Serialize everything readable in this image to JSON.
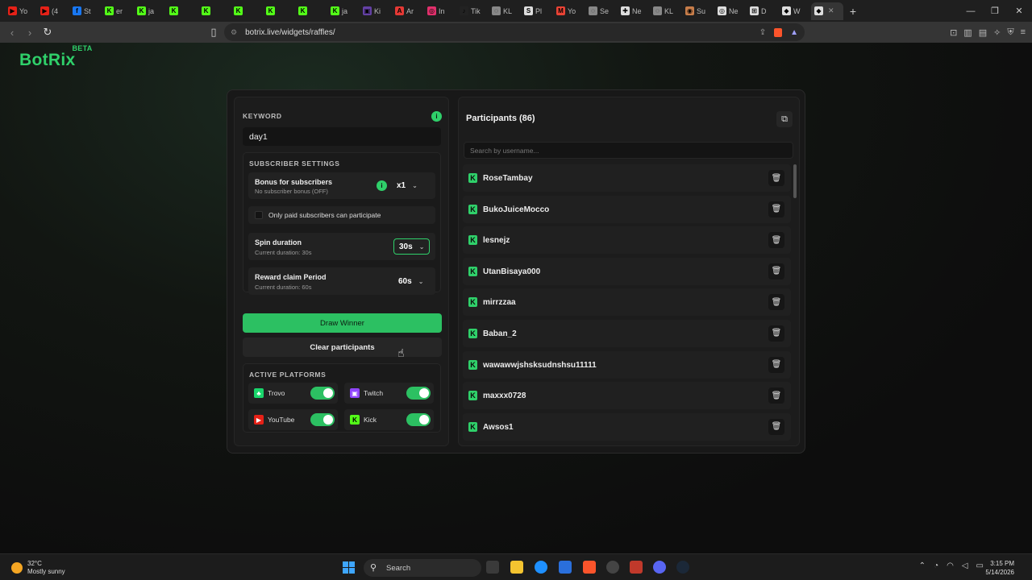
{
  "browser": {
    "tabs": [
      {
        "label": "Yo",
        "color": "#e62117",
        "glyph": "▶"
      },
      {
        "label": "(4",
        "color": "#e62117",
        "glyph": "▶"
      },
      {
        "label": "St",
        "color": "#1877f2",
        "glyph": "f"
      },
      {
        "label": "er",
        "color": "#53fc18",
        "glyph": "K"
      },
      {
        "label": "ja",
        "color": "#53fc18",
        "glyph": "K"
      },
      {
        "label": "",
        "color": "#53fc18",
        "glyph": "K"
      },
      {
        "label": "",
        "color": "#53fc18",
        "glyph": "K"
      },
      {
        "label": "",
        "color": "#53fc18",
        "glyph": "K"
      },
      {
        "label": "",
        "color": "#53fc18",
        "glyph": "K"
      },
      {
        "label": "",
        "color": "#53fc18",
        "glyph": "K"
      },
      {
        "label": "ja",
        "color": "#53fc18",
        "glyph": "K"
      },
      {
        "label": "Ki",
        "color": "#6441a5",
        "glyph": "▣"
      },
      {
        "label": "Ar",
        "color": "#e53935",
        "glyph": "A"
      },
      {
        "label": "In",
        "color": "#e1306c",
        "glyph": "◎"
      },
      {
        "label": "Tik",
        "color": "#222222",
        "glyph": "♪"
      },
      {
        "label": "KL",
        "color": "#888888",
        "glyph": "◌"
      },
      {
        "label": "Pl",
        "color": "#dddddd",
        "glyph": "S"
      },
      {
        "label": "Yo",
        "color": "#ea4335",
        "glyph": "M"
      },
      {
        "label": "Se",
        "color": "#888888",
        "glyph": "◌"
      },
      {
        "label": "Ne",
        "color": "#dddddd",
        "glyph": "✚"
      },
      {
        "label": "KL",
        "color": "#888888",
        "glyph": "◌"
      },
      {
        "label": "Su",
        "color": "#c77d4a",
        "glyph": "◉"
      },
      {
        "label": "Ne",
        "color": "#dddddd",
        "glyph": "◎"
      },
      {
        "label": "D",
        "color": "#dddddd",
        "glyph": "⊞"
      },
      {
        "label": "W",
        "color": "#dddddd",
        "glyph": "◆"
      },
      {
        "label": "",
        "color": "#dddddd",
        "glyph": "◆"
      }
    ],
    "new_tab": "+",
    "url": "botrix.live/widgets/raffles/",
    "win_minimize": "—",
    "win_restore": "❐",
    "win_close": "✕"
  },
  "app": {
    "logo": "BotRix",
    "logo_badge": "BETA"
  },
  "keyword": {
    "label": "KEYWORD",
    "value": "day1",
    "info": "i"
  },
  "subscriber": {
    "label": "SUBSCRIBER SETTINGS",
    "bonus_title": "Bonus for subscribers",
    "bonus_sub": "No subscriber bonus (OFF)",
    "bonus_value": "x1",
    "only_paid": "Only paid subscribers can participate",
    "spin_title": "Spin duration",
    "spin_sub": "Current duration: 30s",
    "spin_value": "30s",
    "reward_title": "Reward claim Period",
    "reward_sub": "Current duration: 60s",
    "reward_value": "60s"
  },
  "actions": {
    "draw": "Draw Winner",
    "clear": "Clear participants"
  },
  "platforms": {
    "label": "ACTIVE PLATFORMS",
    "items": [
      {
        "name": "Trovo",
        "color": "#19d66b",
        "glyph": "♣",
        "enabled": true
      },
      {
        "name": "Twitch",
        "color": "#9146ff",
        "glyph": "▣",
        "enabled": true
      },
      {
        "name": "YouTube",
        "color": "#e62117",
        "glyph": "▶",
        "enabled": true
      },
      {
        "name": "Kick",
        "color": "#53fc18",
        "glyph": "K",
        "enabled": true
      }
    ]
  },
  "participants": {
    "title": "Participants (86)",
    "search_placeholder": "Search by username...",
    "items": [
      "RoseTambay",
      "BukoJuiceMocco",
      "lesnejz",
      "UtanBisaya000",
      "mirrzzaa",
      "Baban_2",
      "wawawwjshsksudnshsu11111",
      "maxxx0728",
      "Awsos1"
    ]
  },
  "taskbar": {
    "temp": "32°C",
    "weather": "Mostly sunny",
    "search": "Search",
    "time": "3:15 PM",
    "date": "5/14/2026"
  },
  "colors": {
    "accent": "#2fd06a",
    "kick": "#53fc18"
  }
}
